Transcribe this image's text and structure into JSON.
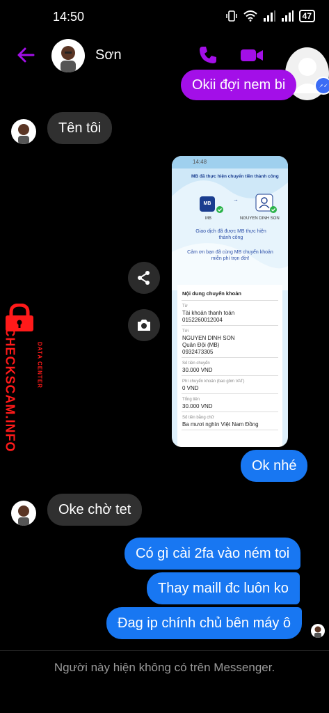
{
  "status_bar": {
    "time": "14:50",
    "battery": "47"
  },
  "header": {
    "contact_name": "Sơn"
  },
  "messages": [
    {
      "dir": "out",
      "text": "Okii đợi nem bi"
    },
    {
      "dir": "in",
      "text": "Tên tôi"
    },
    {
      "dir": "out",
      "text": "Ok nhé"
    },
    {
      "dir": "in",
      "text": "Oke chờ tet"
    },
    {
      "dir": "out",
      "text": "Có gì cài 2fa vào ném toi"
    },
    {
      "dir": "out",
      "text": "Thay maill đc luôn ko"
    },
    {
      "dir": "out",
      "text": "Đag ip chính chủ bên máy ô"
    }
  ],
  "shared_screenshot": {
    "time": "14:48",
    "heading": "MB đã thực hiện chuyển tiền thành công",
    "from_logo": "MB",
    "from_label": "MB",
    "to_label": "NGUYEN DINH SON",
    "success_msg": "Giao dịch đã được MB thực hiện thành công",
    "thanks_msg": "Cảm ơn bạn đã cùng MB chuyển khoản miễn phí trọn đời!",
    "section_title": "Nội dung chuyển khoản",
    "from_field_label": "Từ",
    "from_account_name": "Tài khoản thanh toán",
    "from_account_no": "0152260012004",
    "to_field_label": "Tới",
    "to_name": "NGUYEN DINH SON",
    "to_bank": "Quân Đội (MB)",
    "to_account_no": "0932473305",
    "amount_label": "Số tiền chuyển",
    "amount": "30.000 VND",
    "fee_label": "Phí chuyển khoản (bao gồm VAT)",
    "fee": "0 VND",
    "total_label": "Tổng tiền",
    "total": "30.000 VND",
    "words_label": "Số tiền bằng chữ",
    "words": "Ba mươi nghìn Việt Nam Đồng"
  },
  "watermark": {
    "brand": "CHECKSCAM.INFO",
    "sub": "DATA CENTER"
  },
  "footer": {
    "note": "Người này hiện không có trên Messenger."
  },
  "colors": {
    "accent": "#a30fe8",
    "outgoing": "#1877f2",
    "incoming": "#303030",
    "watermark": "#ff1a1a"
  }
}
